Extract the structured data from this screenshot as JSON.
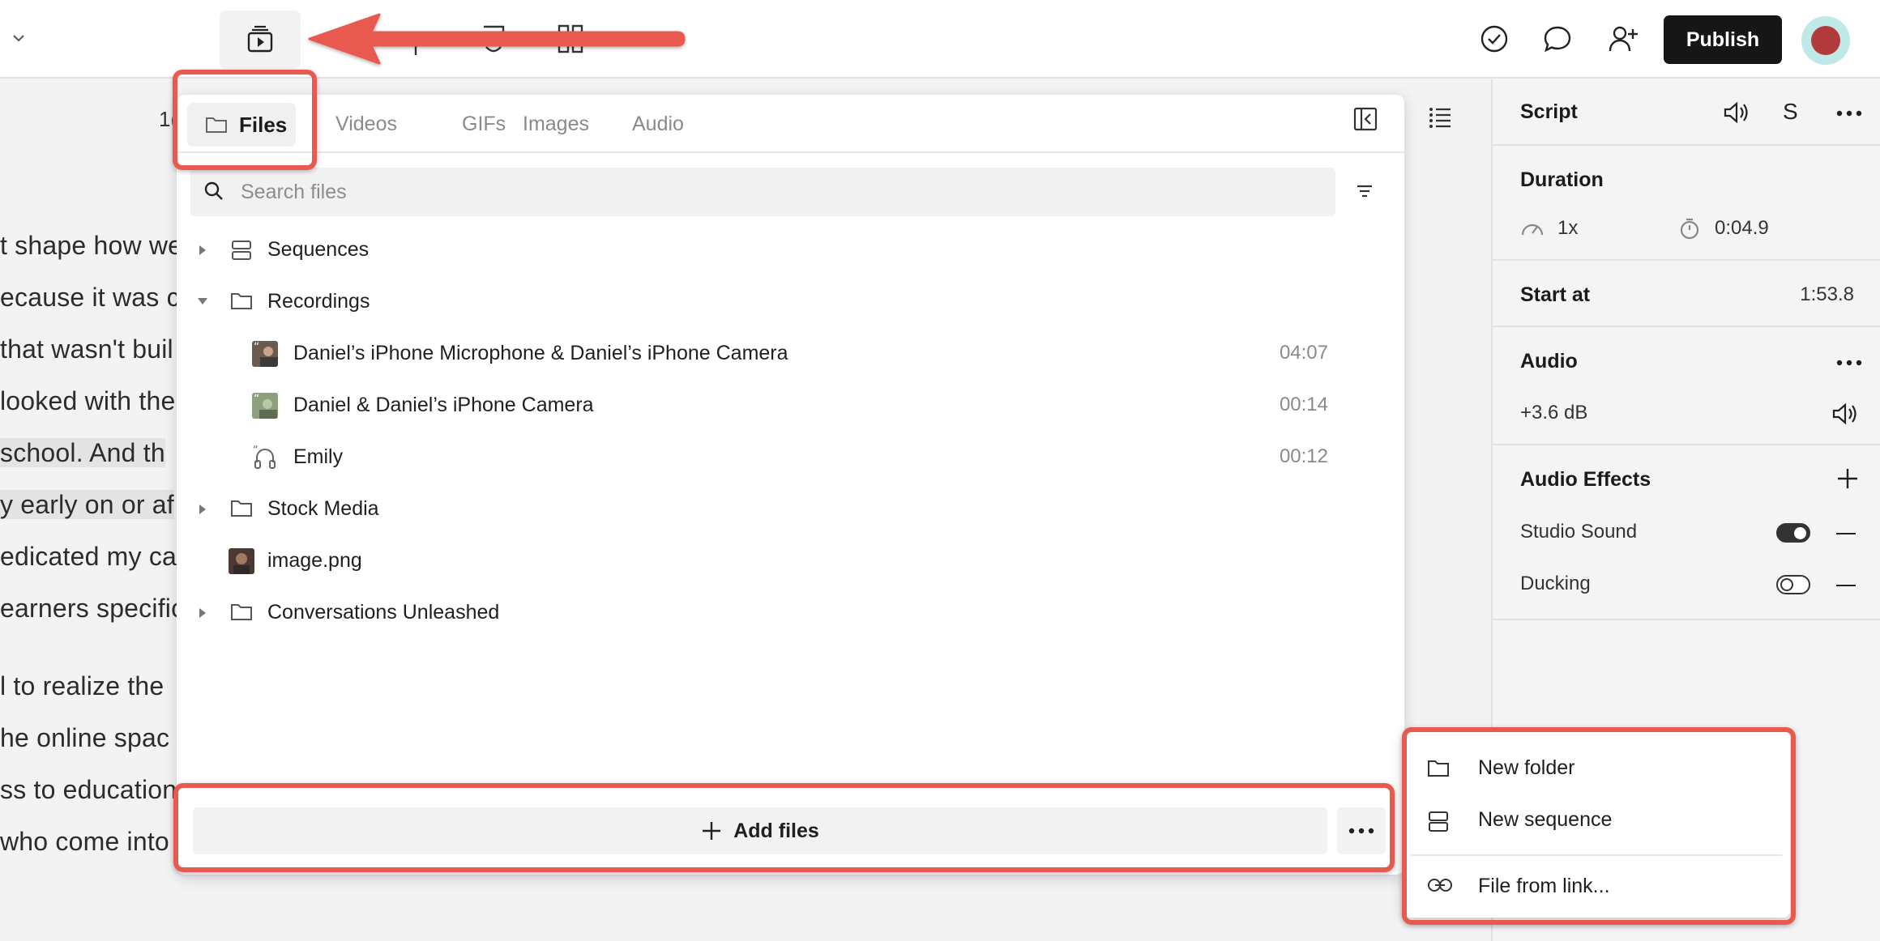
{
  "topbar": {
    "publish_label": "Publish",
    "icons": [
      "chevron-down-icon",
      "media-library-icon",
      "check-circle-icon",
      "comment-icon",
      "add-user-icon"
    ]
  },
  "script_area": {
    "timecode": "1(",
    "lines": [
      "t shape how we",
      "ecause it was c",
      "that wasn't buil",
      "looked with the",
      "school. And th",
      "y early on or af",
      "edicated my ca",
      "earners specific",
      "l to realize the",
      "he online spac",
      "ss to education",
      "who come into"
    ]
  },
  "media_panel": {
    "tabs": [
      {
        "label": "Files",
        "active": true
      },
      {
        "label": "Videos"
      },
      {
        "label": "GIFs"
      },
      {
        "label": "Images"
      },
      {
        "label": "Audio"
      }
    ],
    "search_placeholder": "Search files",
    "tree": [
      {
        "label": "Sequences",
        "type": "sequence",
        "level": 0,
        "expanded": false
      },
      {
        "label": "Recordings",
        "type": "folder",
        "level": 0,
        "expanded": true
      },
      {
        "label": "Daniel’s iPhone Microphone & Daniel’s iPhone Camera",
        "type": "recording",
        "level": 1,
        "duration": "04:07"
      },
      {
        "label": "Daniel & Daniel’s iPhone Camera",
        "type": "recording",
        "level": 1,
        "duration": "00:14"
      },
      {
        "label": "Emily",
        "type": "audio-recording",
        "level": 1,
        "duration": "00:12"
      },
      {
        "label": "Stock Media",
        "type": "folder",
        "level": 0,
        "expanded": false
      },
      {
        "label": "image.png",
        "type": "image",
        "level": 0
      },
      {
        "label": "Conversations Unleashed",
        "type": "folder",
        "level": 0,
        "expanded": false
      }
    ],
    "add_files_label": "Add files"
  },
  "menu": {
    "items": [
      {
        "label": "New folder",
        "icon": "folder-icon"
      },
      {
        "label": "New sequence",
        "icon": "sequence-icon"
      },
      {
        "label": "File from link...",
        "icon": "link-icon"
      }
    ]
  },
  "right_panel": {
    "script_title": "Script",
    "script_s": "S",
    "duration_title": "Duration",
    "speed": "1x",
    "duration_value": "0:04.9",
    "start_label": "Start at",
    "start_value": "1:53.8",
    "audio_title": "Audio",
    "gain": "+3.6 dB",
    "effects_title": "Audio Effects",
    "effects": [
      {
        "label": "Studio Sound",
        "enabled": true
      },
      {
        "label": "Ducking",
        "enabled": false
      }
    ]
  },
  "colors": {
    "annotation": "#e85a50",
    "publish_bg": "#161616",
    "panel_bg": "#ffffff",
    "page_bg": "#f3f3f3"
  }
}
